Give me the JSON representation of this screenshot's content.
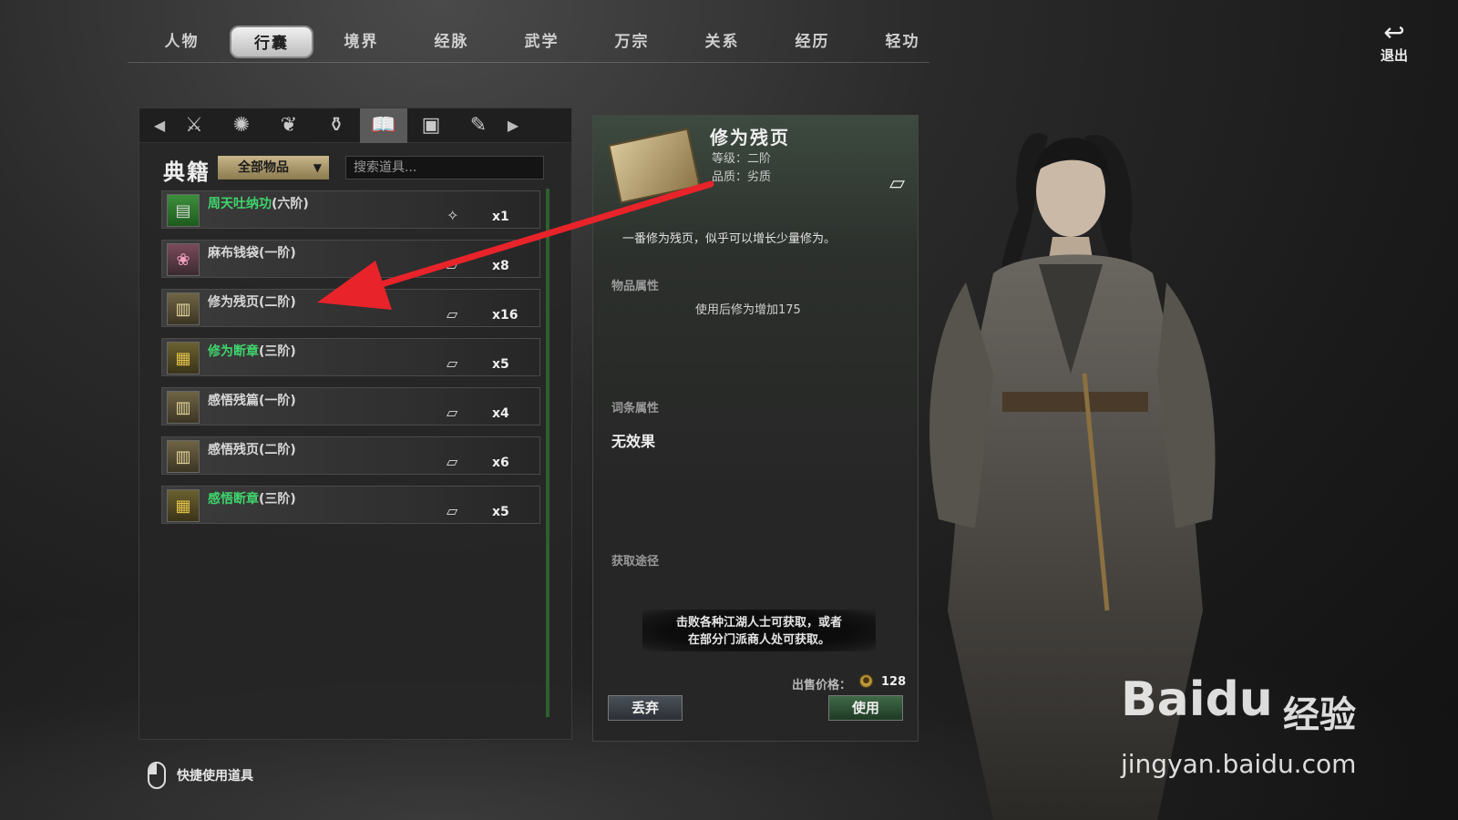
{
  "nav": {
    "tabs": [
      "人物",
      "行囊",
      "境界",
      "经脉",
      "武学",
      "万宗",
      "关系",
      "经历",
      "轻功"
    ],
    "active_index": 1
  },
  "exit": {
    "label": "退出",
    "icon": "return-arrow-icon"
  },
  "inventory": {
    "category_icons": [
      "weapon-icon",
      "hidden-weapon-icon",
      "herb-icon",
      "potion-icon",
      "book-icon",
      "material-icon",
      "misc-icon"
    ],
    "active_category_index": 4,
    "section_label": "典籍",
    "filter_label": "全部物品",
    "search_placeholder": "搜索道具...",
    "items": [
      {
        "name": "周天吐纳功",
        "tier": "(六阶)",
        "qty": "x1",
        "quality_color": "#3fd46c",
        "thumb": "green",
        "type_icon": "martial-art-icon"
      },
      {
        "name": "麻布钱袋",
        "tier": "(一阶)",
        "qty": "x8",
        "quality_color": "#d8d8d8",
        "thumb": "pink",
        "type_icon": "book-icon"
      },
      {
        "name": "修为残页",
        "tier": "(二阶)",
        "qty": "x16",
        "quality_color": "#d8d8d8",
        "thumb": "paper",
        "type_icon": "book-icon"
      },
      {
        "name": "修为断章",
        "tier": "(三阶)",
        "qty": "x5",
        "quality_color": "#3fd46c",
        "thumb": "gold",
        "type_icon": "book-icon"
      },
      {
        "name": "感悟残篇",
        "tier": "(一阶)",
        "qty": "x4",
        "quality_color": "#d8d8d8",
        "thumb": "paper",
        "type_icon": "book-icon"
      },
      {
        "name": "感悟残页",
        "tier": "(二阶)",
        "qty": "x6",
        "quality_color": "#d8d8d8",
        "thumb": "paper",
        "type_icon": "book-icon"
      },
      {
        "name": "感悟断章",
        "tier": "(三阶)",
        "qty": "x5",
        "quality_color": "#3fd46c",
        "thumb": "gold",
        "type_icon": "book-icon"
      }
    ]
  },
  "detail": {
    "title": "修为残页",
    "level": "等级：二阶",
    "quality": "品质：劣质",
    "description": "一番修为残页，似乎可以增长少量修为。",
    "item_attr_header": "物品属性",
    "item_attr": "使用后修为增加175",
    "entry_attr_header": "词条属性",
    "entry_attr": "无效果",
    "source_header": "获取途径",
    "source_line1": "击败各种江湖人士可获取，或者",
    "source_line2": "在部分门派商人处可获取。",
    "price_label": "出售价格：",
    "price_value": "128",
    "discard_label": "丢弃",
    "use_label": "使用"
  },
  "hint": {
    "label": "快捷使用道具"
  },
  "watermark": {
    "brand": "Bai",
    "brand2": "du",
    "jingyan": "经验",
    "url": "jingyan.baidu.com"
  },
  "colors": {
    "annotation_arrow": "#e8232a",
    "use_button": "#2d5233",
    "scrollbar": "#2f5e2f"
  }
}
